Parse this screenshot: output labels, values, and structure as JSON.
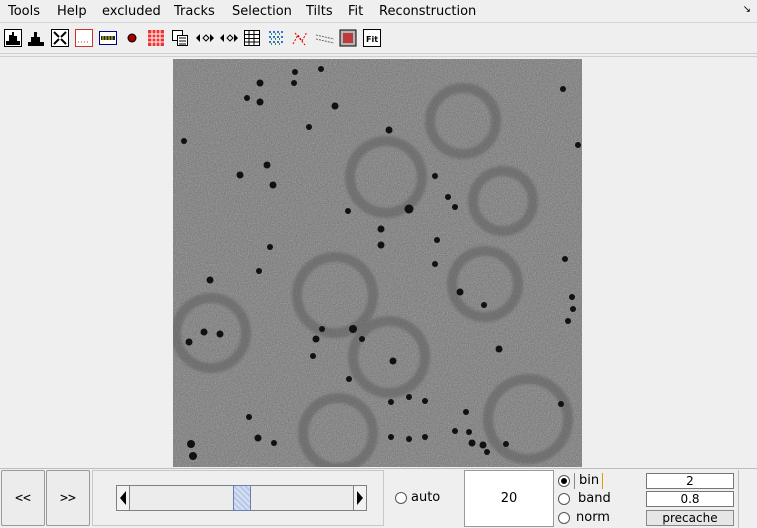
{
  "menu": {
    "items": [
      "Tools",
      "Help",
      "excluded",
      "Tracks",
      "Selection",
      "Tilts",
      "Fit",
      "Reconstruction"
    ],
    "corner_icon": "resize-corner-icon"
  },
  "toolbar": {
    "icons": [
      "histogram-dark-icon",
      "histogram-light-icon",
      "fit-window-icon",
      "grid-dots-icon",
      "scale-bar-icon",
      "red-dot-icon",
      "red-grid-icon",
      "overlay-copy-icon",
      "move-left-icon",
      "move-right-icon",
      "table-icon",
      "particle-grid-icon",
      "red-links-icon",
      "track-lines-icon",
      "frame-box-icon"
    ],
    "fit_label": "Fit"
  },
  "navigation": {
    "prev_label": "<<",
    "next_label": ">>"
  },
  "slider": {
    "value_fraction": 0.5
  },
  "auto": {
    "label": "auto",
    "checked": false
  },
  "frame_value": "20",
  "params": {
    "bin": {
      "label": "bin",
      "value": "2",
      "selected": true
    },
    "band": {
      "label": "band",
      "value": "0.8",
      "selected": false
    },
    "norm": {
      "label": "norm",
      "selected": false
    },
    "precache_label": "precache"
  }
}
